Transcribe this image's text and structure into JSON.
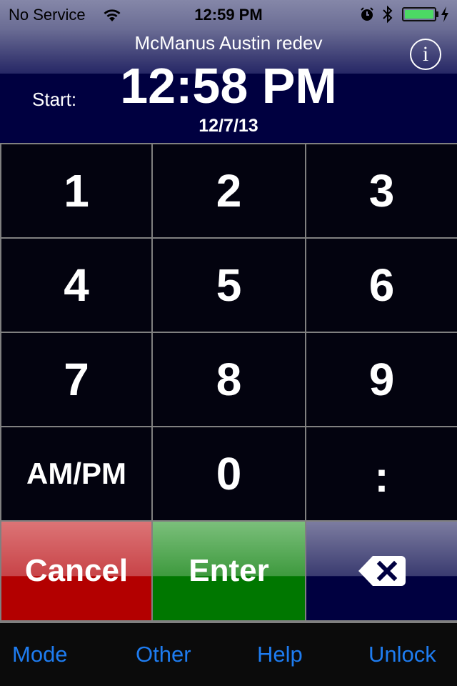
{
  "status_bar": {
    "carrier": "No Service",
    "time": "12:59 PM",
    "battery_percent": 100,
    "icons": [
      "wifi-icon",
      "alarm-icon",
      "bluetooth-icon",
      "battery-icon",
      "charging-bolt-icon"
    ]
  },
  "header": {
    "title": "McManus Austin redev",
    "info_label": "i",
    "start_label": "Start:",
    "time_value": "12:58 PM",
    "date_value": "12/7/13"
  },
  "keypad": {
    "keys": [
      "1",
      "2",
      "3",
      "4",
      "5",
      "6",
      "7",
      "8",
      "9",
      "AM/PM",
      "0",
      ":"
    ]
  },
  "actions": {
    "cancel": "Cancel",
    "enter": "Enter",
    "backspace_icon": "backspace-icon",
    "colors": {
      "cancel": "#b30000",
      "enter": "#007700",
      "backspace": "#000040"
    }
  },
  "tabbar": {
    "items": [
      "Mode",
      "Other",
      "Help",
      "Unlock"
    ],
    "color": "#1e7cf0"
  }
}
